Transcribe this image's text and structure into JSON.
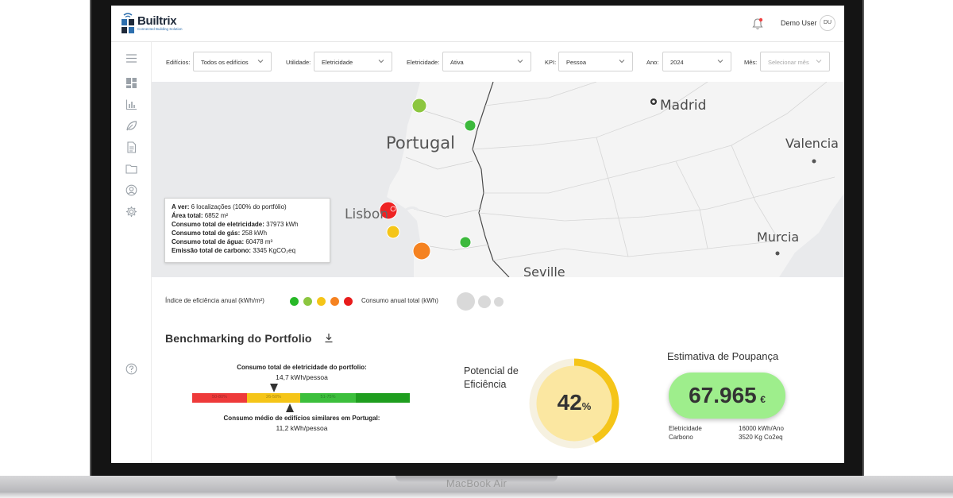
{
  "app": {
    "brand": "Builtrix",
    "tagline": "Connected Building Solution"
  },
  "device": {
    "model_label": "MacBook Air"
  },
  "header": {
    "user_name": "Demo User",
    "user_initials": "DU"
  },
  "sidebar": {
    "items": [
      {
        "icon": "menu-icon"
      },
      {
        "icon": "dashboard-icon"
      },
      {
        "icon": "bar-chart-icon"
      },
      {
        "icon": "leaf-icon"
      },
      {
        "icon": "document-icon"
      },
      {
        "icon": "folder-icon"
      },
      {
        "icon": "user-icon"
      },
      {
        "icon": "gear-icon"
      },
      {
        "icon": "help-icon"
      }
    ]
  },
  "filters": {
    "buildings_label": "Edifícios:",
    "buildings_value": "Todos os edifícios",
    "utility_label": "Utilidade:",
    "utility_value": "Eletricidade",
    "electricity_label": "Eletricidade:",
    "electricity_value": "Ativa",
    "kpi_label": "KPI:",
    "kpi_value": "Pessoa",
    "year_label": "Ano:",
    "year_value": "2024",
    "month_label": "Mês:",
    "month_placeholder": "Selecionar mês"
  },
  "map": {
    "cities": {
      "madrid": "Madrid",
      "portugal": "Portugal",
      "valencia": "Valencia",
      "lisbon": "Lisbon",
      "murcia": "Murcia",
      "seville": "Seville"
    },
    "info": {
      "viewing_label": "A ver:",
      "viewing_value": "6 localizações (100% do portfólio)",
      "area_label": "Área total:",
      "area_value": "6852 m²",
      "elec_label": "Consumo total de eletricidade:",
      "elec_value": "37973 kWh",
      "gas_label": "Consumo total de gás:",
      "gas_value": "258 kWh",
      "water_label": "Consumo total de água:",
      "water_value": "60478 m³",
      "carbon_label": "Emissão total de carbono:",
      "carbon_value": "3345 KgCO₂eq"
    },
    "markers": [
      {
        "color": "#8cc63f"
      },
      {
        "color": "#3cb93c"
      },
      {
        "color": "#ee2222"
      },
      {
        "color": "#f5c518"
      },
      {
        "color": "#f58220"
      },
      {
        "color": "#3cb93c"
      }
    ]
  },
  "legend": {
    "efficiency_label": "Índice de eficiência anual (kWh/m²)",
    "efficiency_colors": [
      "#27b827",
      "#8cc63f",
      "#f5c518",
      "#f58220",
      "#e81c1c"
    ],
    "consumption_label": "Consumo anual total (kWh)"
  },
  "benchmark": {
    "title": "Benchmarking do Portfolio",
    "portfolio_label": "Consumo total de eletricidade do portfolio:",
    "portfolio_value": "14,7 kWh/pessoa",
    "segments": [
      {
        "label": "50-80%",
        "color": "#ee3a3a"
      },
      {
        "label": "26-50%",
        "color": "#f5c518"
      },
      {
        "label": "51-75%",
        "color": "#3cbf3c"
      },
      {
        "label": "",
        "color": "#1f9e1f"
      }
    ],
    "similar_label": "Consumo médio de edifícios similares em Portugal:",
    "similar_value": "11,2 kWh/pessoa"
  },
  "potential": {
    "title": "Potencial de Eficiência",
    "value": "42",
    "unit": "%",
    "fraction": 0.42
  },
  "savings": {
    "title": "Estimativa de Poupança",
    "amount": "67.965",
    "currency": "€",
    "rows": [
      {
        "label": "Eletricidade",
        "value": "16000 kWh/Ano"
      },
      {
        "label": "Carbono",
        "value": "3520 Kg Co2eq"
      }
    ]
  }
}
